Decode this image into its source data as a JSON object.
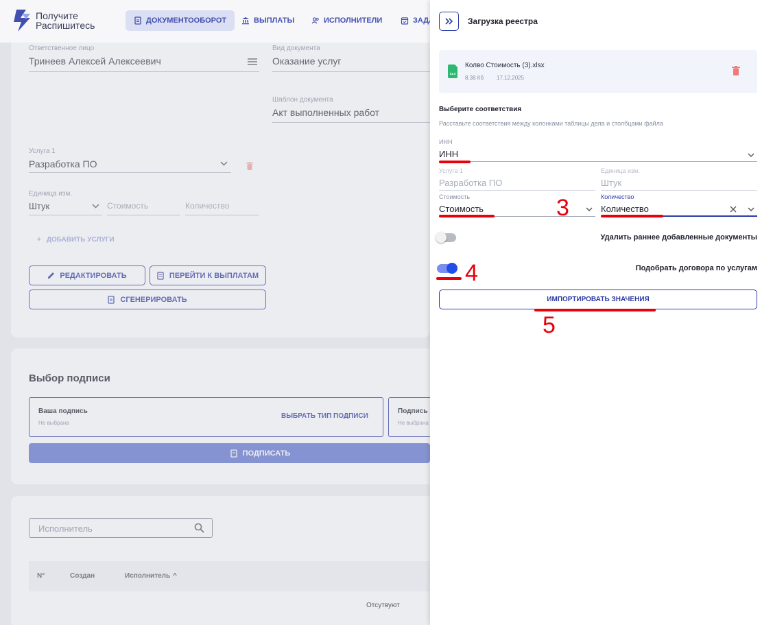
{
  "brand": {
    "line1": "Получите",
    "line2": "Распишитесь"
  },
  "nav": [
    {
      "label": "ДОКУМЕНТООБОРОТ",
      "active": true
    },
    {
      "label": "ВЫПЛАТЫ"
    },
    {
      "label": "ИСПОЛНИТЕЛИ"
    },
    {
      "label": "ЗАДА"
    }
  ],
  "form": {
    "responsible_label": "Ответственное лицо",
    "responsible_value": "Тринеев Алексей Алексеевич",
    "doc_type_label": "Вид документа",
    "doc_type_value": "Оказание услуг",
    "template_label": "Шаблон документа",
    "template_value": "Акт выполненных работ",
    "service_label": "Услуга 1",
    "service_value": "Разработка ПО",
    "unit_label": "Единица изм.",
    "unit_value": "Штук",
    "cost_placeholder": "Стоимость",
    "qty_placeholder": "Количество",
    "add_service": "ДОБАВИТЬ УСЛУГИ",
    "edit_btn": "РЕДАКТИРОВАТЬ",
    "payments_btn": "ПЕРЕЙТИ К ВЫПЛАТАМ",
    "generate_btn": "СГЕНЕРИРОВАТЬ"
  },
  "signature": {
    "title": "Выбор подписи",
    "your_label": "Ваша подпись",
    "your_status": "Не выбрана",
    "choose_type": "ВЫБРАТЬ ТИП ПОДПИСИ",
    "other_label": "Подпись",
    "other_status": "Не выбрана",
    "sign_btn": "ПОДПИСАТЬ"
  },
  "list": {
    "search_placeholder": "Исполнитель",
    "col_num": "N°",
    "col_created": "Создан",
    "col_executor": "Исполнитель",
    "empty": "Отсутвуют"
  },
  "drawer": {
    "title": "Загрузка реестра",
    "file_name": "Колво Стоимость (3).xlsx",
    "file_size": "8.38 Кб",
    "file_date": "17.12.2025",
    "file_ext": "XLS",
    "heading": "Выберите соответствия",
    "subheading": "Расставьте соответствия между колонками таблицы дела и столбцами файла",
    "inn_label": "ИНН",
    "inn_value": "ИНН",
    "service_label": "Услуга 1",
    "service_value": "Разработка ПО",
    "unit_label": "Единица изм.",
    "unit_value": "Штук",
    "cost_label": "Стоимость",
    "cost_value": "Стоимость",
    "qty_label": "Количество",
    "qty_value": "Количество",
    "delete_toggle_label": "Удалить раннее добавленные документы",
    "delete_toggle_on": false,
    "match_toggle_label": "Подобрать договора по услугам",
    "match_toggle_on": true,
    "import_btn": "ИМПОРТИРОВАТЬ ЗНАЧЕНИЯ"
  },
  "annotations": {
    "n3": "3",
    "n4": "4",
    "n5": "5"
  },
  "colors": {
    "accent": "#2c3aa8",
    "annotation": "#e8000b",
    "sign_button": "#6175d1",
    "file_icon": "#2eb872",
    "trash": "#f07a7a"
  }
}
